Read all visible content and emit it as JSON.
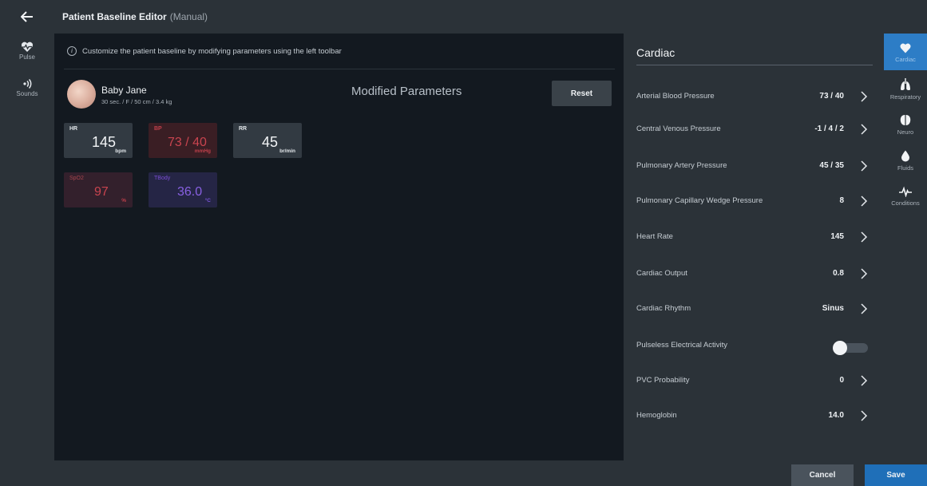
{
  "header": {
    "title": "Patient Baseline Editor",
    "subtitle": "(Manual)"
  },
  "left_rail": {
    "items": [
      {
        "label": "Pulse",
        "icon": "heart-pulse-icon"
      },
      {
        "label": "Sounds",
        "icon": "sound-waves-icon"
      }
    ]
  },
  "info": {
    "text": "Customize the patient baseline by modifying parameters using the left toolbar"
  },
  "patient": {
    "name": "Baby Jane",
    "details": "30 sec. / F / 50 cm / 3.4 kg"
  },
  "modified": {
    "title": "Modified Parameters",
    "reset_label": "Reset"
  },
  "vitals": {
    "hr": {
      "label": "HR",
      "value": "145",
      "unit": "bpm"
    },
    "bp": {
      "label": "BP",
      "value": "73 / 40",
      "unit": "mmHg"
    },
    "rr": {
      "label": "RR",
      "value": "45",
      "unit": "br/min"
    },
    "spo2": {
      "label": "SpO2",
      "value": "97",
      "unit": "%"
    },
    "tbody": {
      "label": "TBody",
      "value": "36.0",
      "unit": "°C"
    }
  },
  "panel": {
    "title": "Cardiac",
    "params": [
      {
        "name": "Arterial Blood Pressure",
        "value": "73 / 40"
      },
      {
        "name": "Central Venous Pressure",
        "value": "-1 / 4 / 2"
      },
      {
        "name": "Pulmonary Artery Pressure",
        "value": "45 / 35"
      },
      {
        "name": "Pulmonary Capillary Wedge Pressure",
        "value": "8"
      },
      {
        "name": "Heart Rate",
        "value": "145"
      },
      {
        "name": "Cardiac Output",
        "value": "0.8"
      },
      {
        "name": "Cardiac Rhythm",
        "value": "Sinus"
      },
      {
        "name": "Pulseless Electrical Activity",
        "value": ""
      },
      {
        "name": "PVC Probability",
        "value": "0"
      },
      {
        "name": "Hemoglobin",
        "value": "14.0"
      }
    ],
    "pea_enabled": false
  },
  "right_rail": {
    "items": [
      {
        "label": "Cardiac",
        "icon": "heart-icon",
        "active": true
      },
      {
        "label": "Respiratory",
        "icon": "lungs-icon",
        "active": false
      },
      {
        "label": "Neuro",
        "icon": "brain-icon",
        "active": false
      },
      {
        "label": "Fluids",
        "icon": "droplet-icon",
        "active": false
      },
      {
        "label": "Conditions",
        "icon": "pulse-line-icon",
        "active": false
      }
    ]
  },
  "footer": {
    "cancel_label": "Cancel",
    "save_label": "Save"
  },
  "colors": {
    "accent": "#1f6fb8",
    "active_tab": "#2d7dc6",
    "bp": "#c8444f",
    "spo2": "#c8444f",
    "temp": "#8860e2"
  }
}
